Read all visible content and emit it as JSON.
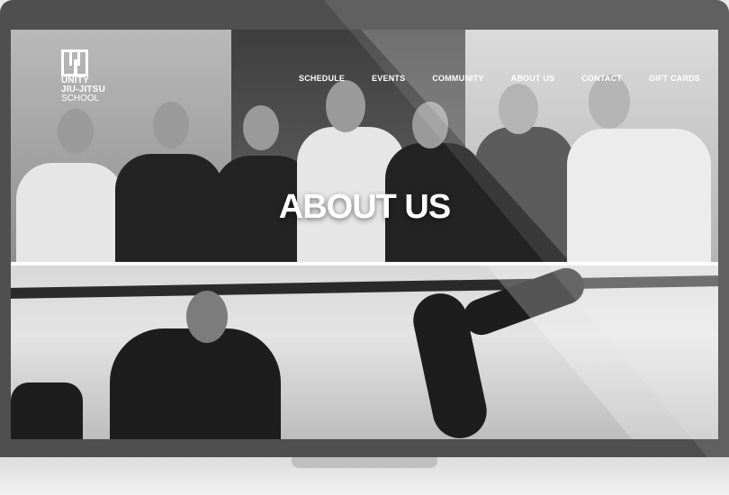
{
  "site": {
    "logo": {
      "line1": "UNITY",
      "line2": "JIU-JITSU",
      "line3": "SCHOOL"
    },
    "nav": [
      "SCHEDULE",
      "EVENTS",
      "COMMUNITY",
      "ABOUT US",
      "CONTACT",
      "GIFT CARDS"
    ],
    "hero_title": "ABOUT US"
  },
  "colors": {
    "frame": "#4f4f4f",
    "text": "#ffffff"
  }
}
